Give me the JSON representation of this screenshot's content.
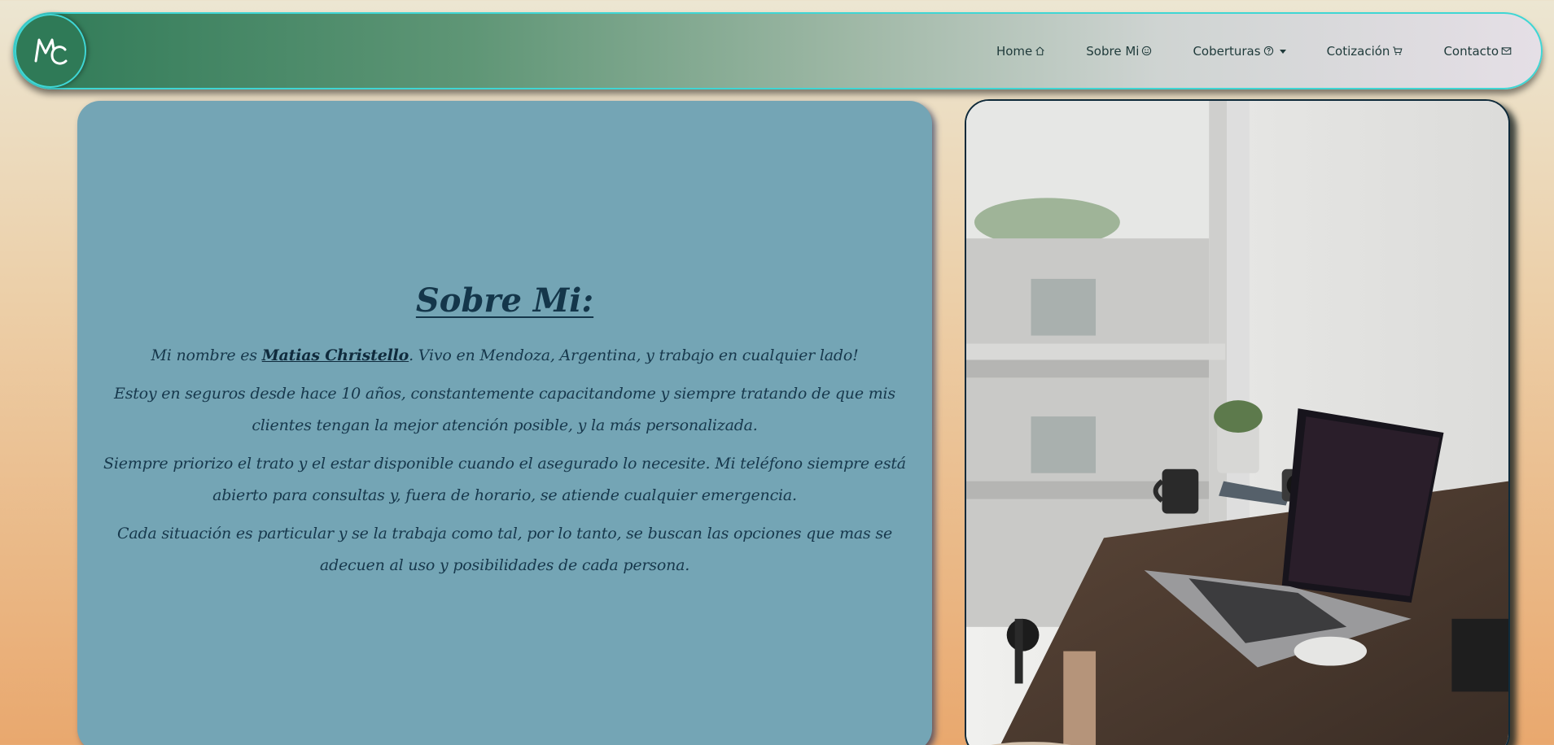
{
  "logo": {
    "initials": "MC",
    "icon": "mc-monogram-logo"
  },
  "nav": {
    "items": [
      {
        "label": "Home",
        "icon": "house-icon"
      },
      {
        "label": "Sobre Mi",
        "icon": "smile-icon"
      },
      {
        "label": "Coberturas",
        "icon": "question-circle-icon",
        "dropdown": true
      },
      {
        "label": "Cotización",
        "icon": "cart-icon"
      },
      {
        "label": "Contacto",
        "icon": "mail-icon"
      }
    ]
  },
  "about": {
    "title": "Sobre Mi:",
    "intro_before": "Mi nombre es ",
    "name": "Matias Christello",
    "intro_after": ". Vivo en Mendoza, Argentina, y trabajo en cualquier lado!",
    "p2": "Estoy en seguros desde hace 10 años, constantemente capacitandome y siempre tratando de que mis clientes tengan la mejor atención posible, y la más personalizada.",
    "p3": "Siempre priorizo el trato y el estar disponible cuando el asegurado lo necesite. Mi teléfono siempre está abierto para consultas y, fuera de horario, se atiende cualquier emergencia.",
    "p4": "Cada situación es particular y se la trabaja como tal, por lo tanto, se buscan las opciones que mas se adecuen al uso y posibilidades de cada persona."
  },
  "colors": {
    "nav_border": "#3fd6d4",
    "nav_start": "#2f7a57",
    "card_bg": "#74a5b5",
    "text": "#17384c"
  }
}
